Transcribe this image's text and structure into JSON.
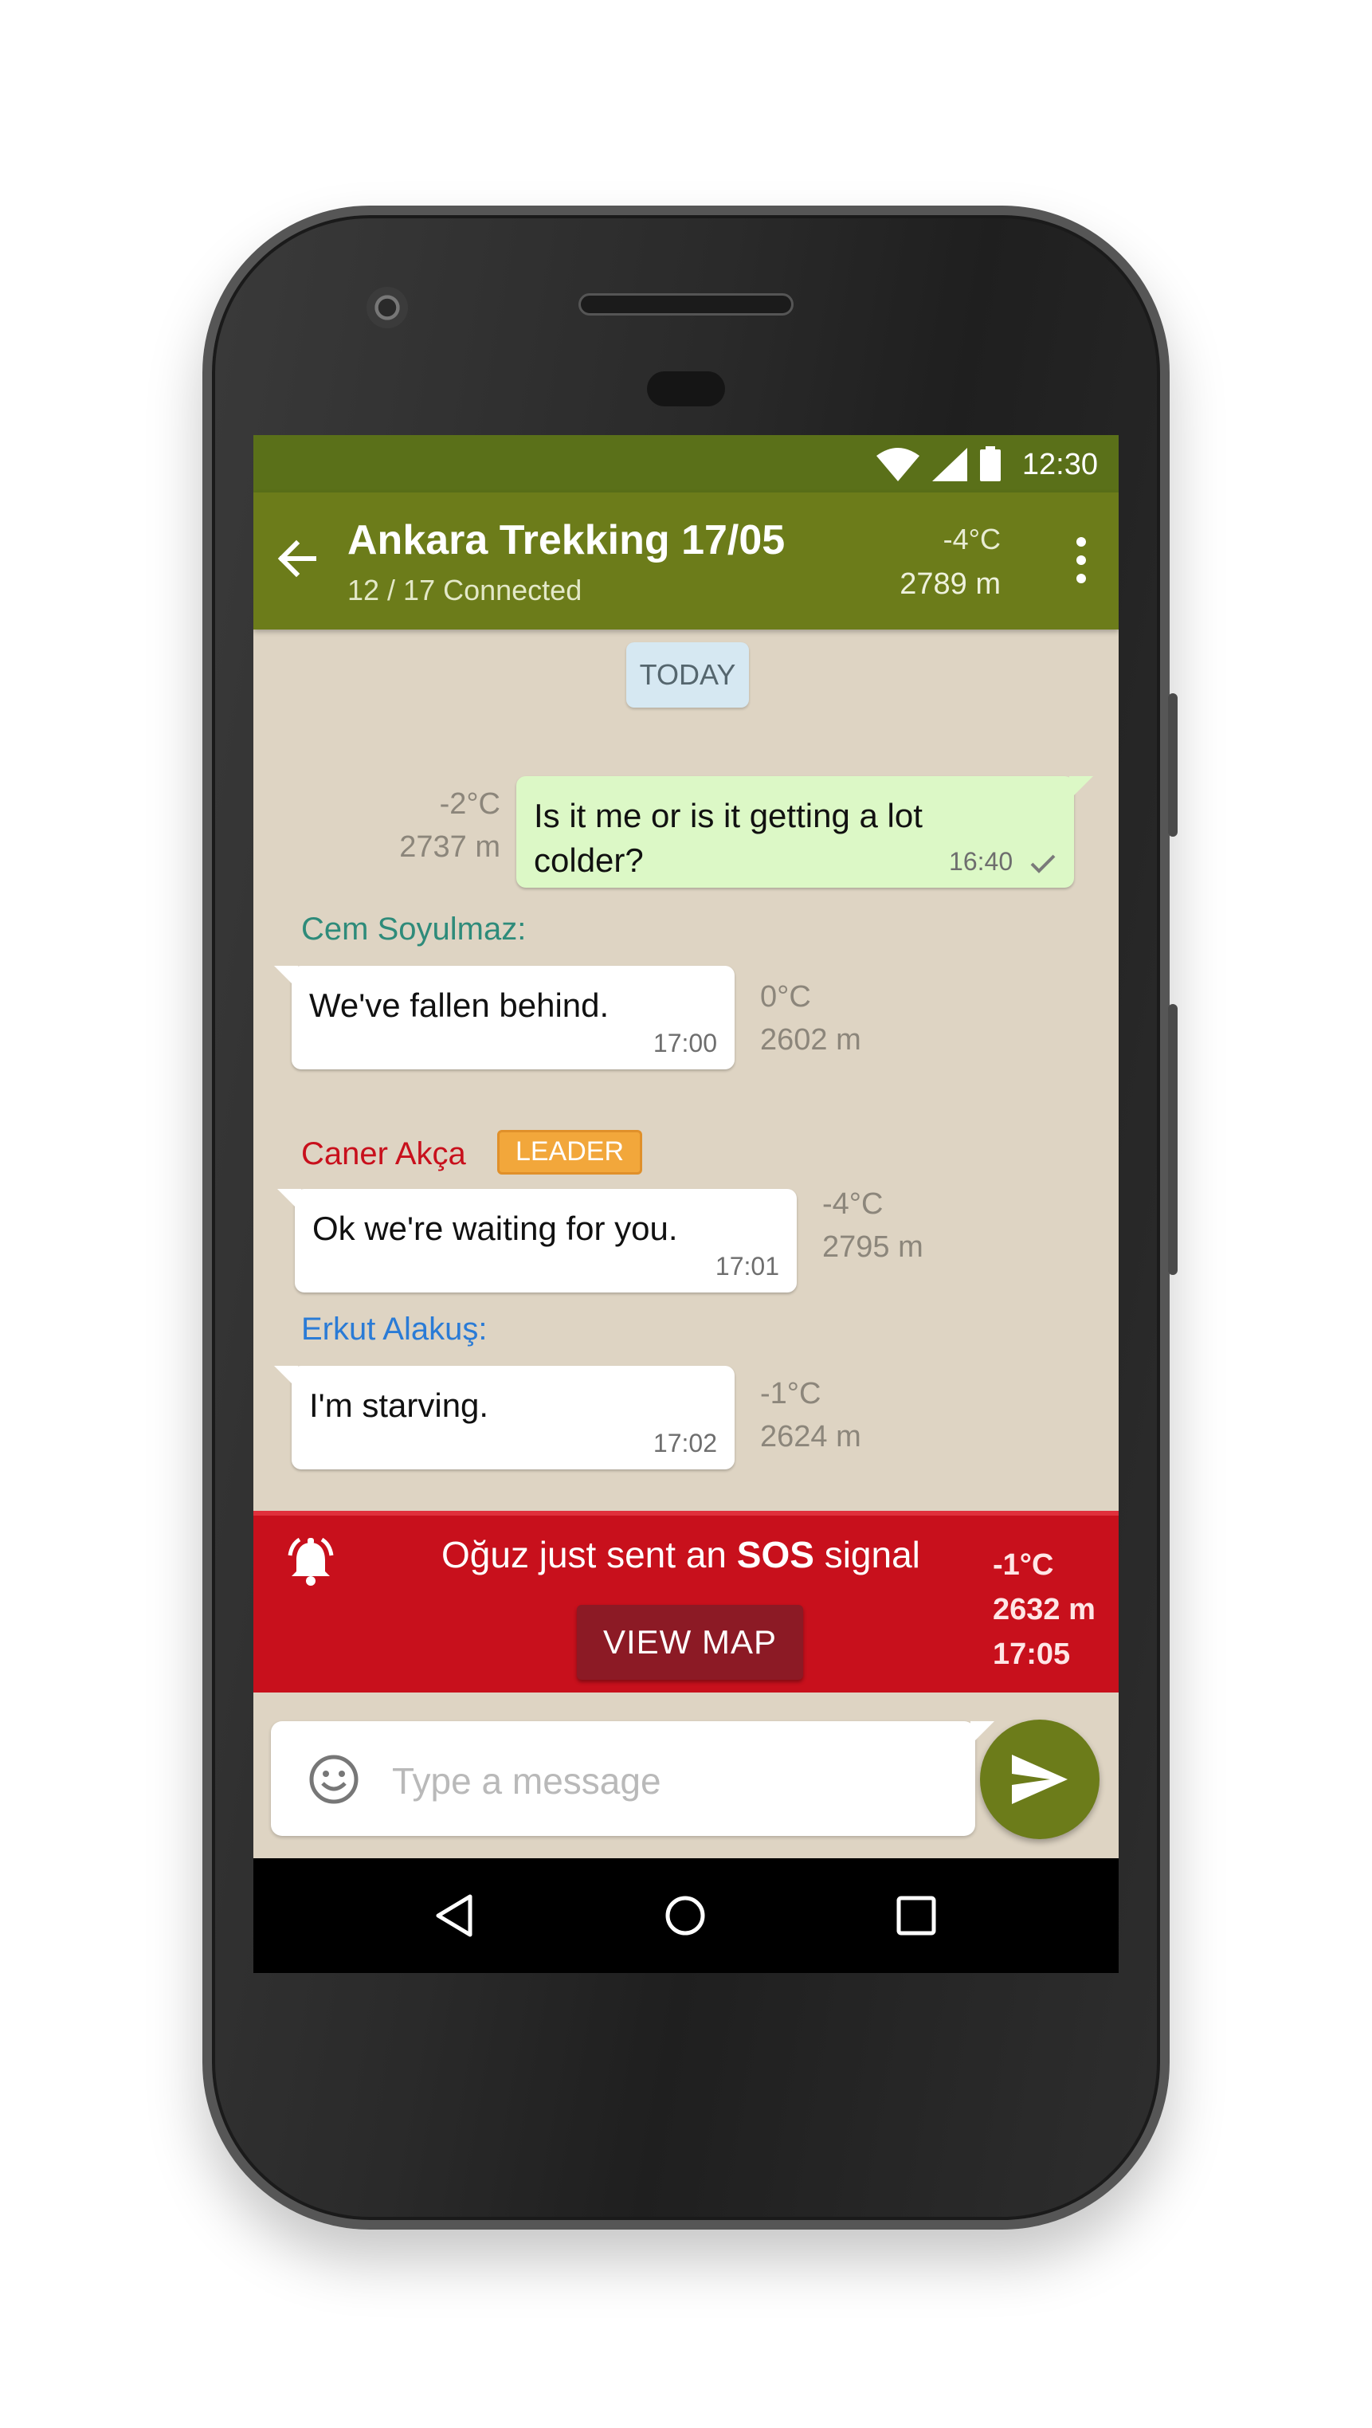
{
  "status_bar": {
    "time": "12:30"
  },
  "app_bar": {
    "title": "Ankara Trekking 17/05",
    "subtitle": "12 / 17 Connected",
    "temperature": "-4°C",
    "altitude": "2789 m"
  },
  "date_chip": "TODAY",
  "messages": [
    {
      "direction": "outgoing",
      "text_line1": "Is it me or is it getting a lot",
      "text_line2": "colder?",
      "time": "16:40",
      "temp": "-2°C",
      "altitude": "2737 m"
    },
    {
      "direction": "incoming",
      "sender": "Cem Soyulmaz:",
      "text": "We've fallen behind.",
      "time": "17:00",
      "temp": "0°C",
      "altitude": "2602 m"
    },
    {
      "direction": "incoming",
      "sender": "Caner Akça",
      "badge": "LEADER",
      "text": "Ok we're waiting for you.",
      "time": "17:01",
      "temp": "-4°C",
      "altitude": "2795 m"
    },
    {
      "direction": "incoming",
      "sender": "Erkut Alakuş:",
      "text": "I'm starving.",
      "time": "17:02",
      "temp": "-1°C",
      "altitude": "2624 m"
    }
  ],
  "sos_banner": {
    "text_before": "Oğuz just sent an ",
    "text_bold": "SOS",
    "text_after": " signal",
    "button": "VIEW MAP",
    "temp": "-1°C",
    "altitude": "2632 m",
    "time": "17:05"
  },
  "composer": {
    "placeholder": "Type a message"
  },
  "colors": {
    "primary": "#6c7c1a",
    "status_bar": "#5a7019",
    "chat_background": "#ded4c3",
    "outgoing_bubble": "#dcf8c6",
    "sos_red": "#c8101c",
    "leader_badge": "#f2a73b",
    "sender_cem": "#2e8b7a",
    "sender_caner": "#c8101c",
    "sender_erkut": "#2a7bd6"
  },
  "icons": {
    "status": [
      "wifi-icon",
      "cell-signal-icon",
      "battery-icon"
    ],
    "app_bar": [
      "back-arrow-icon",
      "overflow-menu-icon"
    ],
    "sos": "bell-alarm-icon",
    "composer": [
      "emoji-icon",
      "send-icon"
    ],
    "navigation": [
      "nav-back-icon",
      "nav-home-icon",
      "nav-recents-icon"
    ]
  }
}
